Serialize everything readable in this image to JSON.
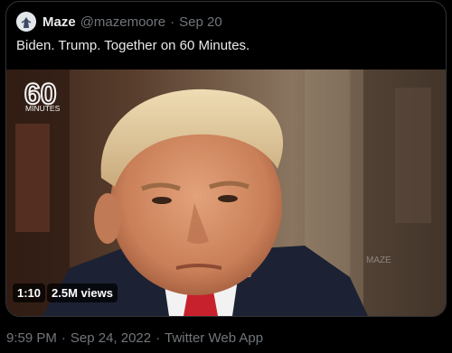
{
  "quoted_tweet": {
    "display_name": "Maze",
    "handle": "@mazemoore",
    "separator": "·",
    "date": "Sep 20",
    "text": "Biden. Trump. Together on 60 Minutes.",
    "media": {
      "logo_number": "60",
      "logo_word": "MINUTES",
      "watermark": "MAZE",
      "duration": "1:10",
      "views": "2.5M views"
    }
  },
  "tweet_meta": {
    "time": "9:59 PM",
    "date": "Sep 24, 2022",
    "source": "Twitter Web App",
    "separator": "·"
  },
  "colors": {
    "text_primary": "#e7e9ea",
    "text_secondary": "#71767b",
    "border": "#2f3336",
    "logo_red": "#e8402f"
  }
}
